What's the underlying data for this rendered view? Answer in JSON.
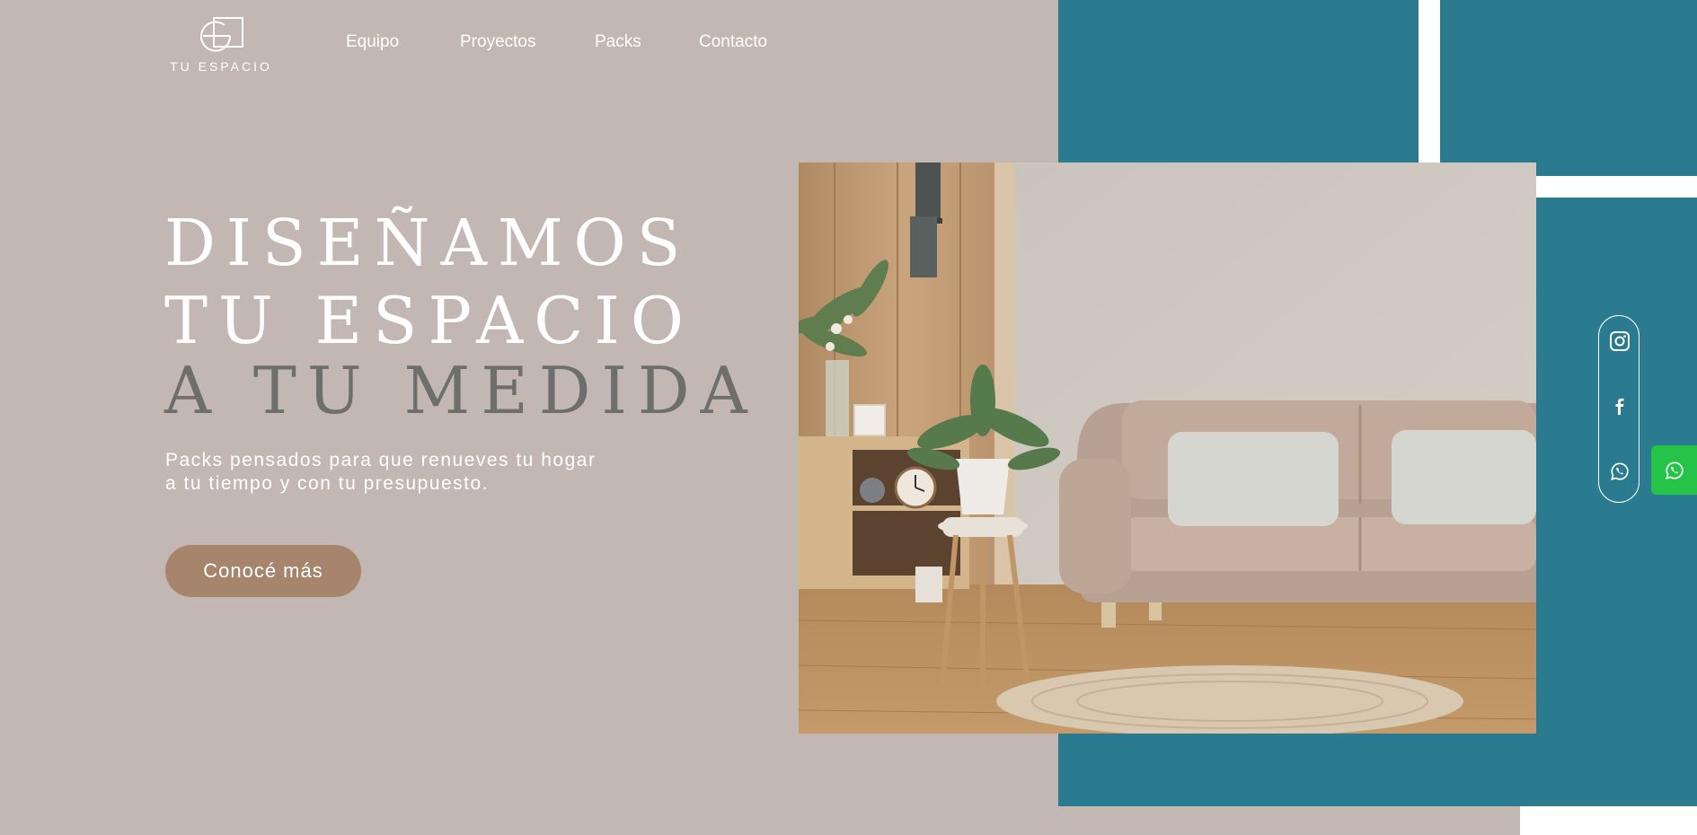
{
  "brand": {
    "name": "TU ESPACIO"
  },
  "nav": {
    "items": [
      {
        "label": "Equipo"
      },
      {
        "label": "Proyectos"
      },
      {
        "label": "Packs"
      },
      {
        "label": "Contacto"
      }
    ]
  },
  "hero": {
    "line1": "DISEÑAMOS",
    "line2": "TU ESPACIO",
    "line3": "A TU MEDIDA",
    "subtitle_line1": "Packs pensados para que renueves tu hogar",
    "subtitle_line2": "a tu tiempo y con tu presupuesto.",
    "cta_label": "Conocé más"
  },
  "social": {
    "icons": [
      "instagram-icon",
      "facebook-icon",
      "whatsapp-icon"
    ],
    "floating": "whatsapp-icon"
  },
  "colors": {
    "background": "#c2b7b3",
    "teal": "#2a7a90",
    "cta": "#a7856d",
    "whatsapp": "#25c449",
    "muted_title": "#6e6e6a"
  }
}
